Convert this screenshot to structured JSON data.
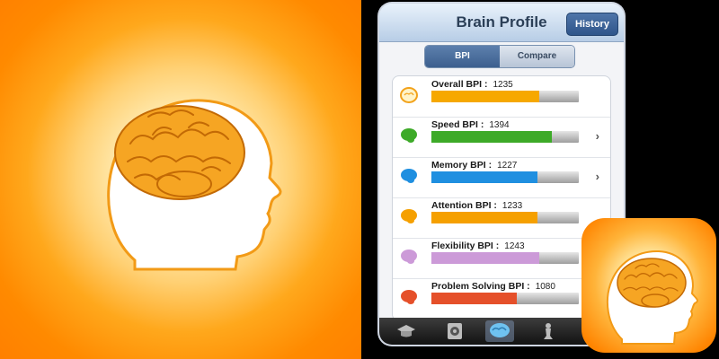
{
  "header": {
    "title": "Brain Profile",
    "history_label": "History"
  },
  "segments": [
    {
      "label": "BPI",
      "active": true
    },
    {
      "label": "Compare",
      "active": false
    }
  ],
  "bpi_rows": [
    {
      "label": "Overall BPI :",
      "score": "1235",
      "fill": 0.73,
      "color": "#f6a800",
      "icon": "brain-outline-icon",
      "chevron": false
    },
    {
      "label": "Speed BPI :",
      "score": "1394",
      "fill": 0.82,
      "color": "#3daa28",
      "icon": "brain-green-icon",
      "chevron": true
    },
    {
      "label": "Memory BPI :",
      "score": "1227",
      "fill": 0.72,
      "color": "#1f8fe0",
      "icon": "brain-blue-icon",
      "chevron": true
    },
    {
      "label": "Attention BPI :",
      "score": "1233",
      "fill": 0.72,
      "color": "#f5a000",
      "icon": "brain-orange-icon",
      "chevron": false
    },
    {
      "label": "Flexibility BPI :",
      "score": "1243",
      "fill": 0.73,
      "color": "#cc9ad8",
      "icon": "brain-purple-icon",
      "chevron": false
    },
    {
      "label": "Problem Solving BPI :",
      "score": "1080",
      "fill": 0.58,
      "color": "#e5502a",
      "icon": "brain-red-icon",
      "chevron": false
    }
  ],
  "tabbar": [
    {
      "icon": "graduation-cap-icon",
      "active": false
    },
    {
      "icon": "target-icon",
      "active": false
    },
    {
      "icon": "brain-tab-icon",
      "active": true
    },
    {
      "icon": "chess-piece-icon",
      "active": false
    }
  ],
  "colors": {
    "accent": "#ff8a00",
    "nav_blue": "#3c5f8e",
    "brain_orange": "#f5a623"
  }
}
